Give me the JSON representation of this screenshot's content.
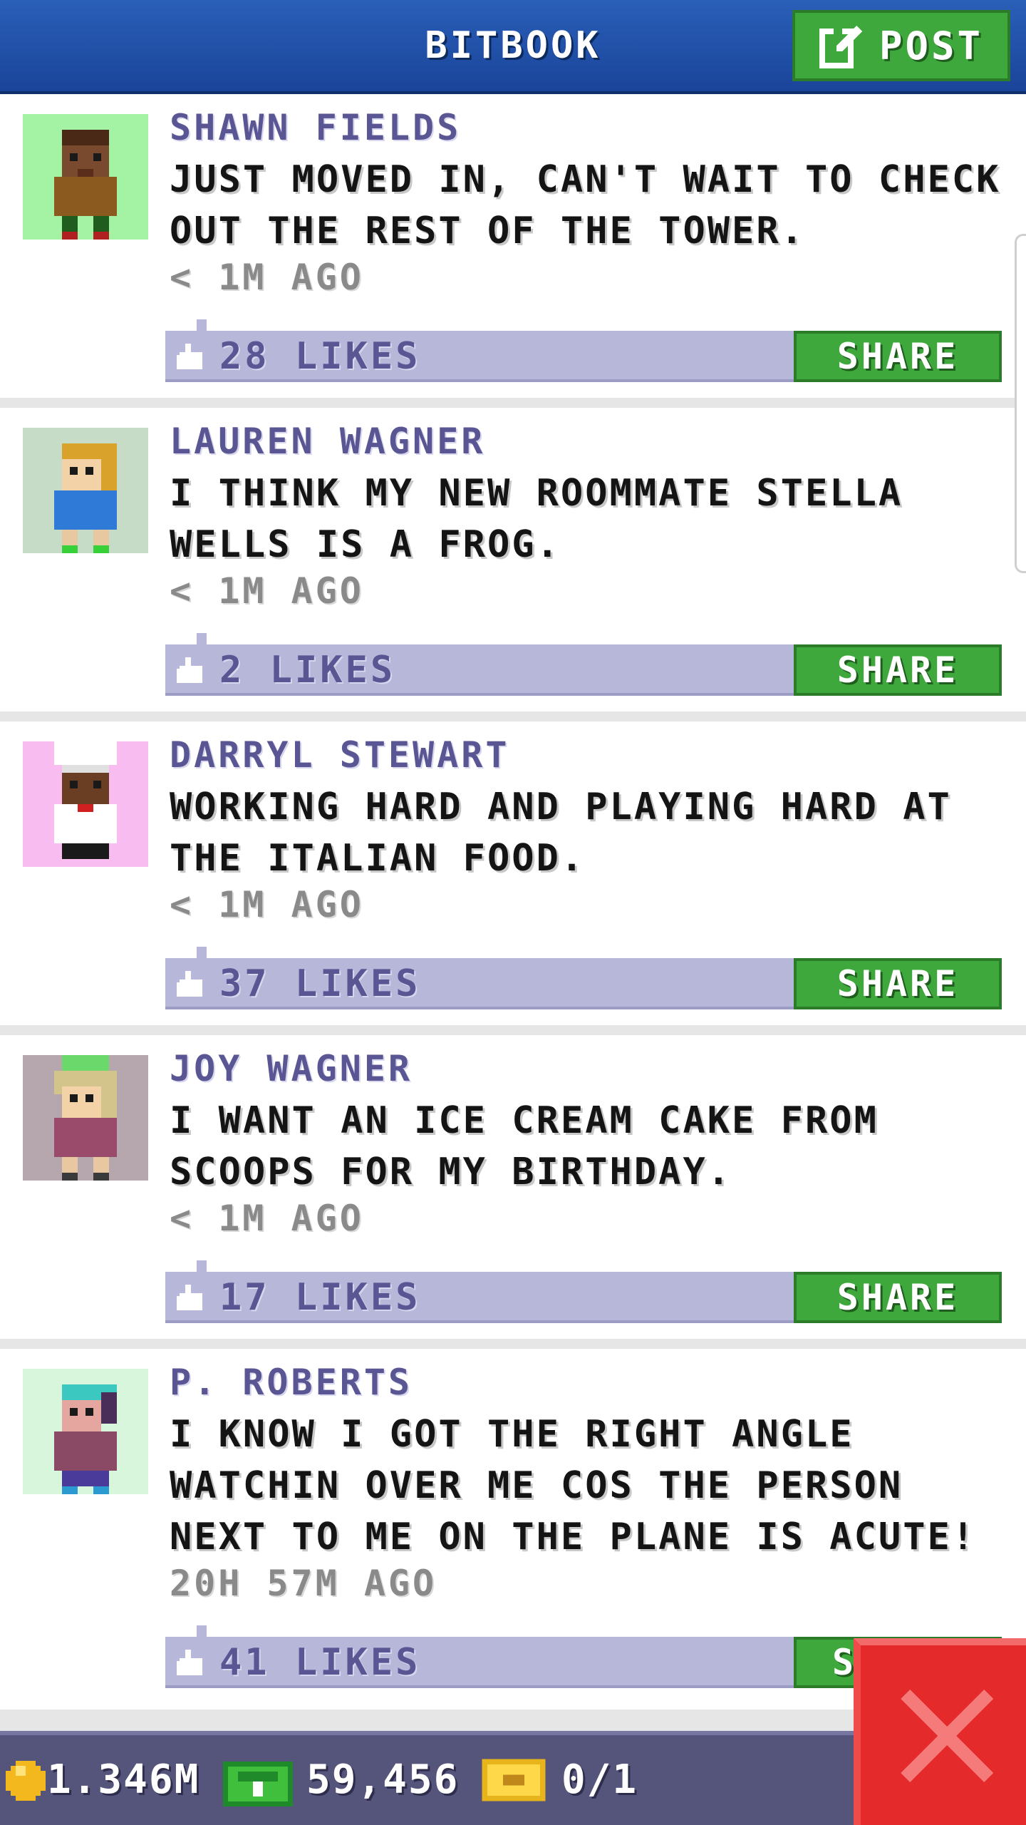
{
  "header": {
    "title": "BITBOOK",
    "post_label": "POST"
  },
  "posts": [
    {
      "author": "SHAWN FIELDS",
      "message": "JUST MOVED IN, CAN'T WAIT TO CHECK OUT THE REST OF THE TOWER.",
      "time": "< 1M AGO",
      "likes": "28 LIKES",
      "share_label": "SHARE",
      "avatar_bg": "#a4f2a4"
    },
    {
      "author": "LAUREN WAGNER",
      "message": "I THINK MY NEW ROOMMATE STELLA WELLS IS A FROG.",
      "time": "< 1M AGO",
      "likes": "2 LIKES",
      "share_label": "SHARE",
      "avatar_bg": "#c6dcc6"
    },
    {
      "author": "DARRYL STEWART",
      "message": "WORKING HARD AND PLAYING HARD AT THE ITALIAN FOOD.",
      "time": "< 1M AGO",
      "likes": "37 LIKES",
      "share_label": "SHARE",
      "avatar_bg": "#f8bcf0"
    },
    {
      "author": "JOY WAGNER",
      "message": "I WANT AN ICE CREAM CAKE FROM SCOOPS FOR MY BIRTHDAY.",
      "time": "< 1M AGO",
      "likes": "17 LIKES",
      "share_label": "SHARE",
      "avatar_bg": "#b6a6ae"
    },
    {
      "author": "P. ROBERTS",
      "message": "I KNOW I GOT THE RIGHT ANGLE WATCHIN OVER ME COS THE PERSON NEXT TO ME ON THE PLANE IS ACUTE!",
      "time": "20H 57M AGO",
      "likes": "41 LIKES",
      "share_label": "SH",
      "avatar_bg": "#d8f6dc"
    }
  ],
  "status_bar": {
    "coins": "1.346M",
    "cash": "59,456",
    "tickets": "0/1"
  },
  "colors": {
    "header": "#1f4ea6",
    "accent_green": "#3fa83c",
    "like_bar": "#b7b7d9",
    "author_text": "#5a5694",
    "close_red": "#e42a2a"
  },
  "icons": [
    "edit-icon",
    "thumbs-up-icon",
    "coin-icon",
    "cash-icon",
    "ticket-icon",
    "close-icon"
  ]
}
